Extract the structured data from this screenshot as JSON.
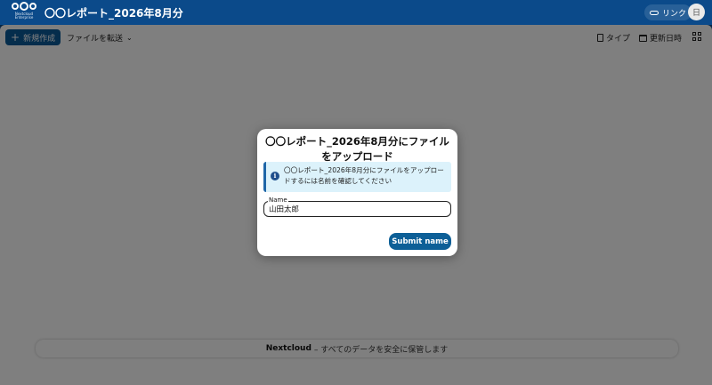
{
  "header": {
    "logo_text_line1": "Nextcloud",
    "logo_text_line2": "Enterprise",
    "title": "〇〇レポート_2026年8月分",
    "link_label": "リンク",
    "avatar_initial": "日"
  },
  "toolbar": {
    "new_label": "新規作成",
    "transfer_label": "ファイルを転送",
    "type_label": "タイプ",
    "modified_label": "更新日時"
  },
  "footer": {
    "brand": "Nextcloud",
    "tagline": "– すべてのデータを安全に保管します"
  },
  "modal": {
    "title": "〇〇レポート_2026年8月分にファイルをアップロード",
    "notice": "〇〇レポート_2026年8月分にファイルをアップロードするには名前を確認してください",
    "field_label": "Name",
    "field_value": "山田太郎",
    "submit_label": "Submit name"
  },
  "colors": {
    "header_bg": "#0b4a8a",
    "primary": "#0d5f97",
    "notice_bg": "#dcf2fb"
  }
}
